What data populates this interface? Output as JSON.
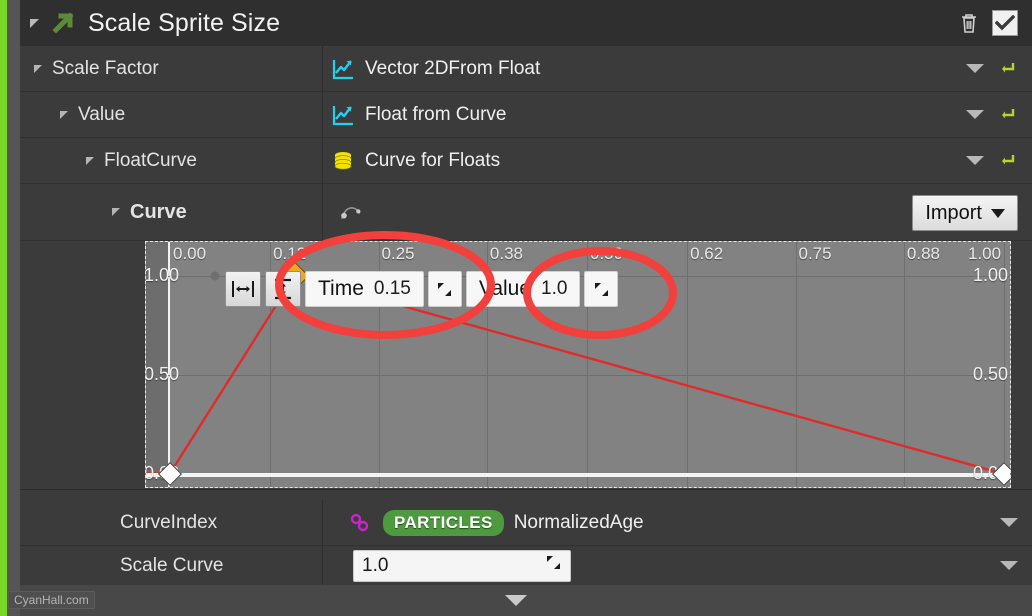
{
  "header": {
    "title": "Scale Sprite Size",
    "expand_icon": "triangle-collapse-icon",
    "module_icon": "green-arrow-icon",
    "delete_icon": "trash-icon",
    "enabled_icon": "checkbox-checked-icon"
  },
  "accent_colors": {
    "green_bar": "#79d725",
    "particles_pill": "#4d9a3f",
    "curve_line": "#e02b2b",
    "selected_key": "#f0a81b",
    "annotation": "#f2403c",
    "icon_cyan": "#1fd2f0",
    "icon_yellow": "#f5e000",
    "link_magenta": "#cc22cc",
    "reset_arrow": "#b4d531"
  },
  "rows": [
    {
      "label": "Scale Factor",
      "value": "Vector 2DFrom Float",
      "icon": "curve-chart-icon",
      "indent": 0,
      "has_dropdown": true,
      "has_reset": true
    },
    {
      "label": "Value",
      "value": "Float from Curve",
      "icon": "curve-chart-icon",
      "indent": 1,
      "has_dropdown": true,
      "has_reset": true
    },
    {
      "label": "FloatCurve",
      "value": "Curve for Floats",
      "icon": "database-stack-icon",
      "indent": 2,
      "has_dropdown": true,
      "has_reset": true
    },
    {
      "label": "Curve",
      "value": "",
      "icon": "curve-keys-icon",
      "indent": 3,
      "bold": true,
      "has_dropdown": false,
      "has_reset": false
    }
  ],
  "import": {
    "label": "Import",
    "caret_icon": "chevron-down-icon"
  },
  "key_editor": {
    "fit_horizontal_icon": "fit-horizontal-icon",
    "fit_vertical_icon": "fit-vertical-icon",
    "time_label": "Time",
    "time_value": "0.15",
    "value_label": "Value",
    "value_value": "1.0",
    "spinner_icon": "drag-spinner-icon"
  },
  "bottom_rows": [
    {
      "label": "CurveIndex",
      "link_icon": "link-chain-icon",
      "badge": "PARTICLES",
      "value": "NormalizedAge",
      "has_dropdown": true,
      "is_field": false
    },
    {
      "label": "Scale Curve",
      "value": "1.0",
      "has_dropdown": true,
      "is_field": true,
      "spinner_icon": "drag-spinner-icon"
    }
  ],
  "footer": {
    "caret_icon": "chevron-down-icon",
    "watermark": "CyanHall.com"
  },
  "chart_data": {
    "type": "line",
    "title": "Curve",
    "xlabel": "",
    "ylabel": "",
    "xlim": [
      0.0,
      1.0
    ],
    "ylim": [
      0.0,
      1.0
    ],
    "grid": true,
    "x_ticks": [
      "0.00",
      "0.12",
      "0.25",
      "0.38",
      "0.50",
      "0.62",
      "0.75",
      "0.88",
      "1.00"
    ],
    "x_tick_values": [
      0.0,
      0.12,
      0.25,
      0.38,
      0.5,
      0.62,
      0.75,
      0.88,
      1.0
    ],
    "y_ticks_left": [
      "1.00",
      "0.50",
      "0.00"
    ],
    "y_ticks_right": [
      "1.00",
      "0.50",
      "0.00"
    ],
    "y_tick_values": [
      1.0,
      0.5,
      0.0
    ],
    "series": [
      {
        "name": "FloatCurve",
        "color": "#e02b2b",
        "points": [
          {
            "x": 0.0,
            "y": 0.0,
            "selected": false
          },
          {
            "x": 0.15,
            "y": 1.0,
            "selected": true
          },
          {
            "x": 1.0,
            "y": 0.0,
            "selected": false
          }
        ]
      }
    ]
  }
}
